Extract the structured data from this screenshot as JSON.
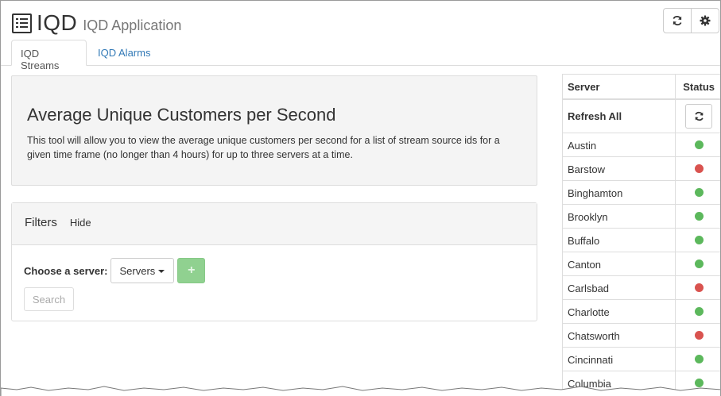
{
  "header": {
    "title": "IQD",
    "subtitle": "IQD Application",
    "refresh_icon": "refresh-icon",
    "settings_icon": "gear-icon"
  },
  "tabs": [
    {
      "label": "IQD Streams",
      "active": true
    },
    {
      "label": "IQD Alarms",
      "active": false
    }
  ],
  "intro": {
    "heading": "Average Unique Customers per Second",
    "description": "This tool will allow you to view the average unique customers per second for a list of stream source ids for a given time frame (no longer than 4 hours) for up to three servers at a time."
  },
  "filters": {
    "title": "Filters",
    "hide_label": "Hide",
    "server_label": "Choose a server:",
    "server_dropdown": "Servers",
    "search_label": "Search"
  },
  "servers": {
    "col_server": "Server",
    "col_status": "Status",
    "refresh_all": "Refresh All",
    "status_colors": {
      "up": "#5cb85c",
      "down": "#d9534f"
    },
    "rows": [
      {
        "name": "Austin",
        "status": "up"
      },
      {
        "name": "Barstow",
        "status": "down"
      },
      {
        "name": "Binghamton",
        "status": "up"
      },
      {
        "name": "Brooklyn",
        "status": "up"
      },
      {
        "name": "Buffalo",
        "status": "up"
      },
      {
        "name": "Canton",
        "status": "up"
      },
      {
        "name": "Carlsbad",
        "status": "down"
      },
      {
        "name": "Charlotte",
        "status": "up"
      },
      {
        "name": "Chatsworth",
        "status": "down"
      },
      {
        "name": "Cincinnati",
        "status": "up"
      },
      {
        "name": "Columbia",
        "status": "up"
      }
    ]
  }
}
